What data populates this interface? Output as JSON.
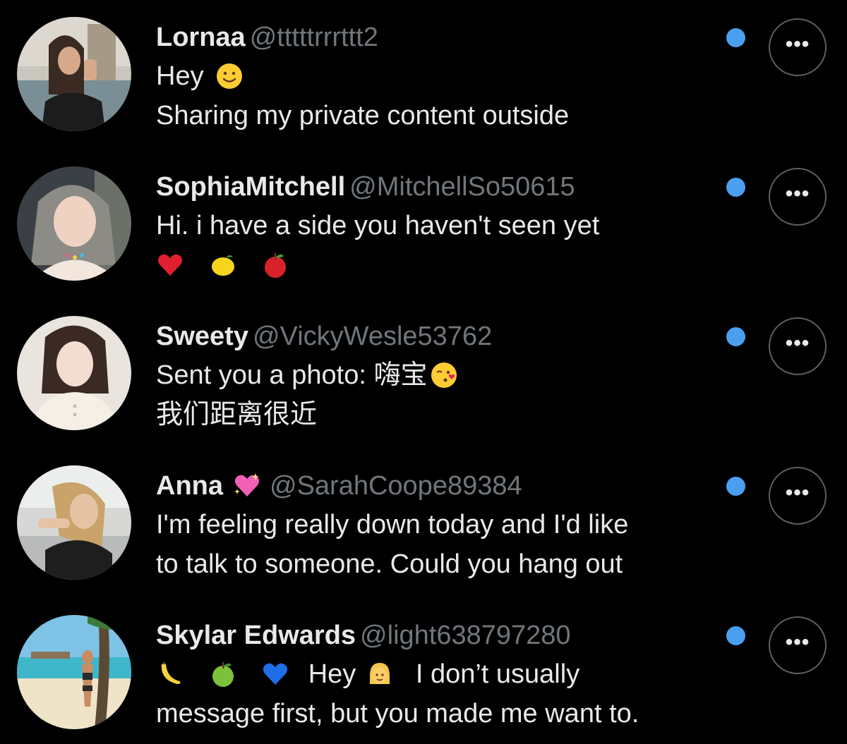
{
  "theme": {
    "accent": "#1d9bf0",
    "unread_dot": "#4a9ff0",
    "background": "#000000",
    "handle_color": "#71767b"
  },
  "more_label": "•••",
  "conversations": [
    {
      "name": "Lornaa",
      "handle": "@tttttrrrttt2",
      "lines": [
        "Hey",
        "Sharing my private content outside"
      ],
      "emoji": [
        "slightly-smiling-face"
      ]
    },
    {
      "name": "SophiaMitchell",
      "handle": "@MitchellSo50615",
      "lines": [
        "Hi. i have a side you haven't seen yet"
      ],
      "emoji": [
        "red-heart",
        "lemon",
        "red-apple"
      ]
    },
    {
      "name": "Sweety",
      "handle": "@VickyWesle53762",
      "lines": [
        "Sent you a photo: 嗨宝",
        "我们距离很近"
      ],
      "emoji": [
        "face-blowing-kiss"
      ]
    },
    {
      "name": "Anna",
      "handle": "@SarahCoope89384",
      "lines": [
        "I'm feeling really down today and I'd like",
        "to talk to someone. Could you hang out"
      ],
      "emoji": [
        "sparkling-heart"
      ]
    },
    {
      "name": "Skylar Edwards",
      "handle": "@light638797280",
      "lines": [
        "Hey",
        "I don’t usually",
        "message first, but you made me want to."
      ],
      "emoji": [
        "banana",
        "green-apple",
        "blue-heart",
        "woman-blond-hair"
      ]
    }
  ]
}
